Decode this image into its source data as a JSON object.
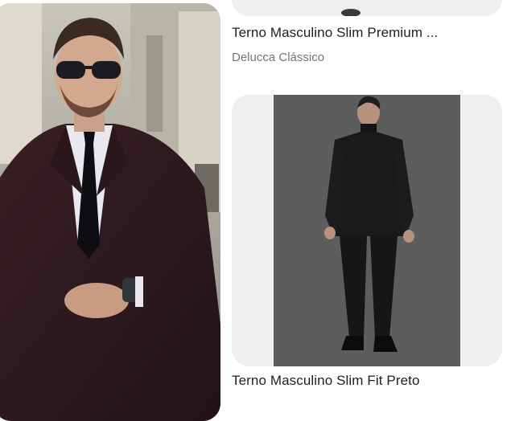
{
  "pins": [
    {
      "title": "Terno Masculino Slim Premium ...",
      "source": "Delucca Clássico"
    },
    {
      "title": "Terno Masculino Slim Fit Preto"
    }
  ],
  "colors": {
    "card_background": "#efefef",
    "title_text": "#1f1f1f",
    "subtitle_text": "#767676"
  }
}
